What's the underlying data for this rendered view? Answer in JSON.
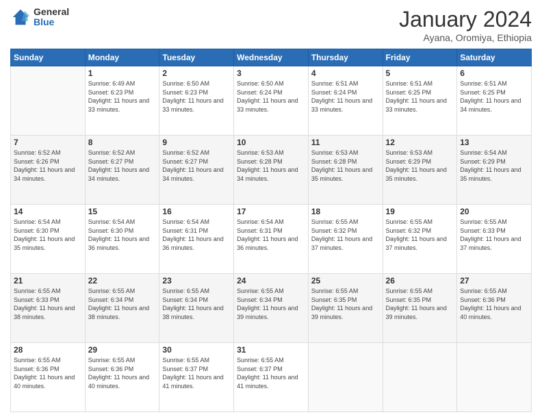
{
  "logo": {
    "general": "General",
    "blue": "Blue"
  },
  "title": "January 2024",
  "subtitle": "Ayana, Oromiya, Ethiopia",
  "days_of_week": [
    "Sunday",
    "Monday",
    "Tuesday",
    "Wednesday",
    "Thursday",
    "Friday",
    "Saturday"
  ],
  "weeks": [
    [
      {
        "day": "",
        "sunrise": "",
        "sunset": "",
        "daylight": ""
      },
      {
        "day": "1",
        "sunrise": "Sunrise: 6:49 AM",
        "sunset": "Sunset: 6:23 PM",
        "daylight": "Daylight: 11 hours and 33 minutes."
      },
      {
        "day": "2",
        "sunrise": "Sunrise: 6:50 AM",
        "sunset": "Sunset: 6:23 PM",
        "daylight": "Daylight: 11 hours and 33 minutes."
      },
      {
        "day": "3",
        "sunrise": "Sunrise: 6:50 AM",
        "sunset": "Sunset: 6:24 PM",
        "daylight": "Daylight: 11 hours and 33 minutes."
      },
      {
        "day": "4",
        "sunrise": "Sunrise: 6:51 AM",
        "sunset": "Sunset: 6:24 PM",
        "daylight": "Daylight: 11 hours and 33 minutes."
      },
      {
        "day": "5",
        "sunrise": "Sunrise: 6:51 AM",
        "sunset": "Sunset: 6:25 PM",
        "daylight": "Daylight: 11 hours and 33 minutes."
      },
      {
        "day": "6",
        "sunrise": "Sunrise: 6:51 AM",
        "sunset": "Sunset: 6:25 PM",
        "daylight": "Daylight: 11 hours and 34 minutes."
      }
    ],
    [
      {
        "day": "7",
        "sunrise": "Sunrise: 6:52 AM",
        "sunset": "Sunset: 6:26 PM",
        "daylight": "Daylight: 11 hours and 34 minutes."
      },
      {
        "day": "8",
        "sunrise": "Sunrise: 6:52 AM",
        "sunset": "Sunset: 6:27 PM",
        "daylight": "Daylight: 11 hours and 34 minutes."
      },
      {
        "day": "9",
        "sunrise": "Sunrise: 6:52 AM",
        "sunset": "Sunset: 6:27 PM",
        "daylight": "Daylight: 11 hours and 34 minutes."
      },
      {
        "day": "10",
        "sunrise": "Sunrise: 6:53 AM",
        "sunset": "Sunset: 6:28 PM",
        "daylight": "Daylight: 11 hours and 34 minutes."
      },
      {
        "day": "11",
        "sunrise": "Sunrise: 6:53 AM",
        "sunset": "Sunset: 6:28 PM",
        "daylight": "Daylight: 11 hours and 35 minutes."
      },
      {
        "day": "12",
        "sunrise": "Sunrise: 6:53 AM",
        "sunset": "Sunset: 6:29 PM",
        "daylight": "Daylight: 11 hours and 35 minutes."
      },
      {
        "day": "13",
        "sunrise": "Sunrise: 6:54 AM",
        "sunset": "Sunset: 6:29 PM",
        "daylight": "Daylight: 11 hours and 35 minutes."
      }
    ],
    [
      {
        "day": "14",
        "sunrise": "Sunrise: 6:54 AM",
        "sunset": "Sunset: 6:30 PM",
        "daylight": "Daylight: 11 hours and 35 minutes."
      },
      {
        "day": "15",
        "sunrise": "Sunrise: 6:54 AM",
        "sunset": "Sunset: 6:30 PM",
        "daylight": "Daylight: 11 hours and 36 minutes."
      },
      {
        "day": "16",
        "sunrise": "Sunrise: 6:54 AM",
        "sunset": "Sunset: 6:31 PM",
        "daylight": "Daylight: 11 hours and 36 minutes."
      },
      {
        "day": "17",
        "sunrise": "Sunrise: 6:54 AM",
        "sunset": "Sunset: 6:31 PM",
        "daylight": "Daylight: 11 hours and 36 minutes."
      },
      {
        "day": "18",
        "sunrise": "Sunrise: 6:55 AM",
        "sunset": "Sunset: 6:32 PM",
        "daylight": "Daylight: 11 hours and 37 minutes."
      },
      {
        "day": "19",
        "sunrise": "Sunrise: 6:55 AM",
        "sunset": "Sunset: 6:32 PM",
        "daylight": "Daylight: 11 hours and 37 minutes."
      },
      {
        "day": "20",
        "sunrise": "Sunrise: 6:55 AM",
        "sunset": "Sunset: 6:33 PM",
        "daylight": "Daylight: 11 hours and 37 minutes."
      }
    ],
    [
      {
        "day": "21",
        "sunrise": "Sunrise: 6:55 AM",
        "sunset": "Sunset: 6:33 PM",
        "daylight": "Daylight: 11 hours and 38 minutes."
      },
      {
        "day": "22",
        "sunrise": "Sunrise: 6:55 AM",
        "sunset": "Sunset: 6:34 PM",
        "daylight": "Daylight: 11 hours and 38 minutes."
      },
      {
        "day": "23",
        "sunrise": "Sunrise: 6:55 AM",
        "sunset": "Sunset: 6:34 PM",
        "daylight": "Daylight: 11 hours and 38 minutes."
      },
      {
        "day": "24",
        "sunrise": "Sunrise: 6:55 AM",
        "sunset": "Sunset: 6:34 PM",
        "daylight": "Daylight: 11 hours and 39 minutes."
      },
      {
        "day": "25",
        "sunrise": "Sunrise: 6:55 AM",
        "sunset": "Sunset: 6:35 PM",
        "daylight": "Daylight: 11 hours and 39 minutes."
      },
      {
        "day": "26",
        "sunrise": "Sunrise: 6:55 AM",
        "sunset": "Sunset: 6:35 PM",
        "daylight": "Daylight: 11 hours and 39 minutes."
      },
      {
        "day": "27",
        "sunrise": "Sunrise: 6:55 AM",
        "sunset": "Sunset: 6:36 PM",
        "daylight": "Daylight: 11 hours and 40 minutes."
      }
    ],
    [
      {
        "day": "28",
        "sunrise": "Sunrise: 6:55 AM",
        "sunset": "Sunset: 6:36 PM",
        "daylight": "Daylight: 11 hours and 40 minutes."
      },
      {
        "day": "29",
        "sunrise": "Sunrise: 6:55 AM",
        "sunset": "Sunset: 6:36 PM",
        "daylight": "Daylight: 11 hours and 40 minutes."
      },
      {
        "day": "30",
        "sunrise": "Sunrise: 6:55 AM",
        "sunset": "Sunset: 6:37 PM",
        "daylight": "Daylight: 11 hours and 41 minutes."
      },
      {
        "day": "31",
        "sunrise": "Sunrise: 6:55 AM",
        "sunset": "Sunset: 6:37 PM",
        "daylight": "Daylight: 11 hours and 41 minutes."
      },
      {
        "day": "",
        "sunrise": "",
        "sunset": "",
        "daylight": ""
      },
      {
        "day": "",
        "sunrise": "",
        "sunset": "",
        "daylight": ""
      },
      {
        "day": "",
        "sunrise": "",
        "sunset": "",
        "daylight": ""
      }
    ]
  ]
}
